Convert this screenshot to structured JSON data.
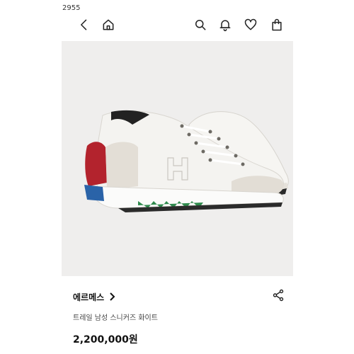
{
  "top_code": "2955",
  "toolbar": {
    "back_icon": "chevron-left-icon",
    "home_icon": "home-icon",
    "search_icon": "search-icon",
    "notification_icon": "bell-icon",
    "wishlist_icon": "heart-icon",
    "cart_icon": "shopping-bag-icon"
  },
  "product": {
    "brand": "에르메스",
    "name": "트레일 남성 스니커즈 화이트",
    "price": "2,200,000원",
    "image_alt_icon": "sneaker-image"
  },
  "colors": {
    "shoe_white": "#f4f3f0",
    "heel_red": "#b3232d",
    "heel_blue": "#2a63a8",
    "sole_green": "#2f8a4d",
    "background": "#efeeed"
  }
}
